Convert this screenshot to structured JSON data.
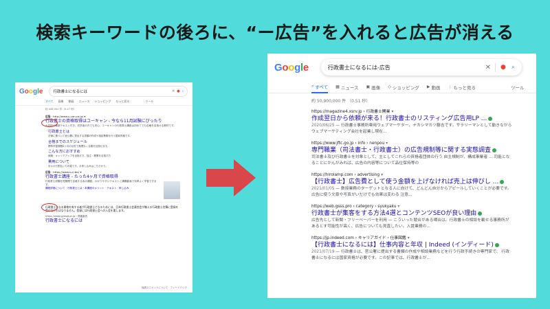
{
  "headline": "検索キーワードの後ろに、“ー広告”を入れると広告が消える",
  "colors": {
    "background": "#52dbdb",
    "arrow": "#d9474a",
    "link": "#1a0dab",
    "highlight": "#d6262f"
  },
  "left": {
    "logo": "Google",
    "query": "行政書士になるには",
    "tabs": [
      "すべて",
      "画像",
      "動画",
      "ニュース",
      "ショッピング",
      "もっと見る",
      "ツール"
    ],
    "stats": "約 448,000 件（0.47 秒）",
    "ad1": {
      "label": "広告",
      "url": "· http://www.u-can.co.jp/ ▾",
      "title": "行政書士の資格取得はユーキャン - 今なら11月試験にぴったり",
      "desc": "大好評の最新テキスト付き。初学者の方でも安心。ユーキャンの行政書士講座は初めてでも合格を目指せる教材です。",
      "sublinks": [
        {
          "title": "行政書士とは",
          "desc": "法律に基づいて官公署に提出する書類の作成や相談業務を行う国家資格です。"
        },
        {
          "title": "合格までのスケジュール",
          "desc": "標準学習期間8ヶ月の目安で無理なく合格を目指せます。"
        },
        {
          "title": "こんな方におすすめ",
          "desc": "就職・キャリアアップを目指す方、独立・開業を目指す方"
        },
        {
          "title": "費用について",
          "desc": "月々の分割払いも可能です。お申し込みはこちらから。"
        }
      ]
    },
    "ad2": {
      "label": "広告",
      "url": "· https://www.s-cj.biz/ ▾",
      "title": "行政書士講座 - たった4ヶ月で資格取得",
      "desc": "行政書士試験を短期間で合格する為の講座。わかりやすいテキストと講義動画で効率よく学習できます。",
      "links": "講座詳細について · 行政書士とは · 本講座のメリット · テキスト · 申し込み"
    },
    "snippet": "行政書士となる資格を有する者が行政書士となるためには、日本行政書士会連合会が備える行政書士名簿に登録を受けなければなりません。登録には行政書士会への入会を要します。",
    "snippet_url": "https://www.gyosei.or.jp › 資格案内",
    "snippet_title": "行政書士になるには",
    "footer": "強調スニペットについて · フィードバック"
  },
  "right": {
    "logo": "Google",
    "query": "行政書士になるには-広告",
    "tabs": [
      {
        "icon": "⌕",
        "label": "すべて",
        "active": true
      },
      {
        "icon": "▦",
        "label": "ニュース"
      },
      {
        "icon": "▣",
        "label": "画像"
      },
      {
        "icon": "◇",
        "label": "ショッピング"
      },
      {
        "icon": "▶",
        "label": "動画"
      },
      {
        "icon": "⋮",
        "label": "もっと見る"
      }
    ],
    "tools": "ツール",
    "stats": "約 50,900,000 件 （0.51 秒）",
    "results": [
      {
        "url": "https://magazine4.xsrv.jp › 行政書士開業",
        "title": "作成翌日から依頼が来る！行政書士のリスティング広告用LP ...",
        "date": "2020/06/25",
        "desc": "— 行政書士事務所専用ウェブマーケター、ナカシマカツ藤吉です。サラリーマンとして勤きながらウェブマーケティング会社を起業し現在..."
      },
      {
        "url": "https://www.jftc.go.jp › info › nenpou",
        "title": "専門職業（司法書士・行政書士）の広告規制等に関する実態調査",
        "date": "",
        "desc": "司法書士及び行政書士を対象として、主としてこれらの資格者団体の行う 自主規制が、構成事業者 ... 司能となることにかんがみれば、広告の内容等について品位保持等の"
      },
      {
        "url": "https://hirolamp.com › advertising",
        "title": "【行政書士】広告費として使う金額を上げなければ売上は伸びし ...",
        "date": "2021/01/05",
        "desc": "— 数授業務のターゲットとなる人に向けて、どんどん自分からアピールしていくことが必要です。 広告に使う文章や写真がいだけでも効果は変わる 注意..."
      },
      {
        "url": "https://web.gsss.pro › category › syukyaku",
        "title": "行政書士が集客をする方法4選とコンテンツSEOが良い理由",
        "date": "",
        "desc": "広告先として新聞・フリーペーパーを利用 — こういった競合がある場合は、行政書士の相談を載せる事務所があるとす可能性が高く、広告についても見直したい。入営業務の..."
      },
      {
        "url": "https://jp.indeed.com › キャリアガイド › 仕事図鑑",
        "title": "【行政書士になるには】仕事内容と年収 | Indeed (インディード)",
        "date": "2021/07/19",
        "desc": "— 行政書士は、官公署に提出する書類の作成や相談業務などを行う行政手続きの専門家で、 行政書士になるには国家資格が必要です。この記事では、行政書士が..."
      }
    ]
  }
}
